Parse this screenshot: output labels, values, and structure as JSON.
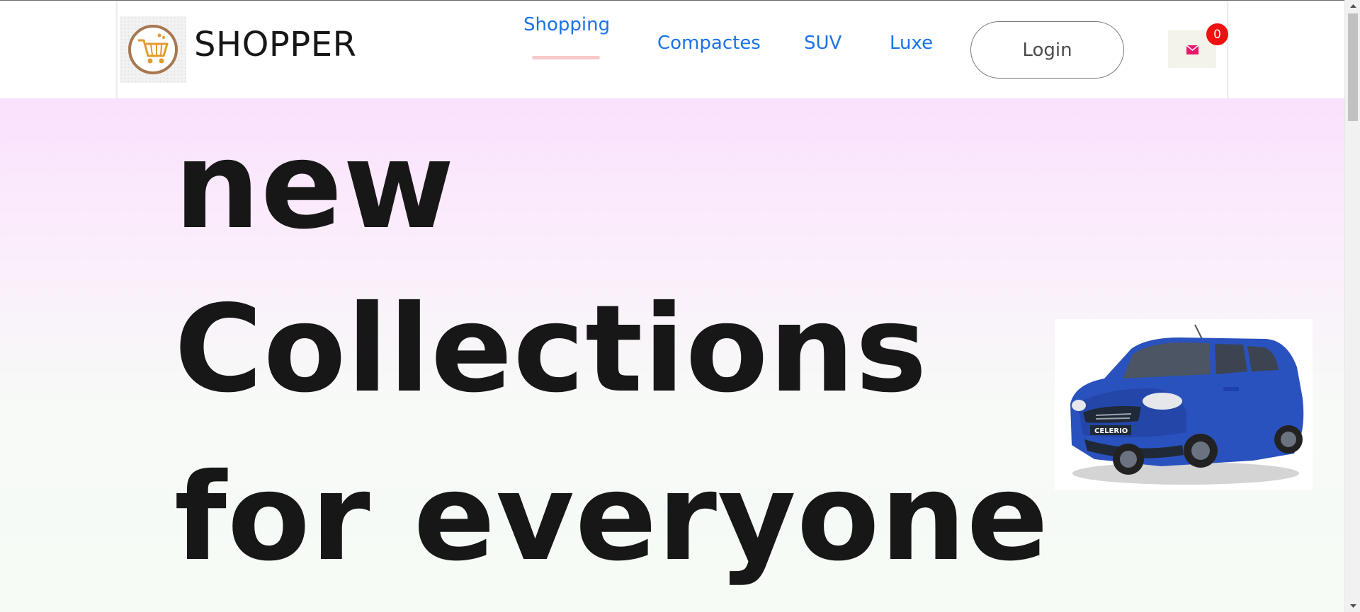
{
  "header": {
    "brand": "SHOPPER",
    "logo_icon": "shopping-cart-icon",
    "nav": {
      "shopping": "Shopping",
      "compactes": "Compactes",
      "suv": "SUV",
      "luxe": "Luxe"
    },
    "active_nav": "Shopping",
    "login_label": "Login",
    "cart_icon": "cart-icon",
    "cart_count": "0"
  },
  "hero": {
    "line1": "new",
    "line2": "Collections",
    "line3": "for everyone",
    "image_icon": "car-image"
  },
  "colors": {
    "nav_link": "#1a73e8",
    "active_underline": "#f8c9c9",
    "badge": "#ee1111",
    "hero_top": "#fae1fd",
    "hero_bottom": "#f6fbf6",
    "car_body": "#2a52be"
  }
}
